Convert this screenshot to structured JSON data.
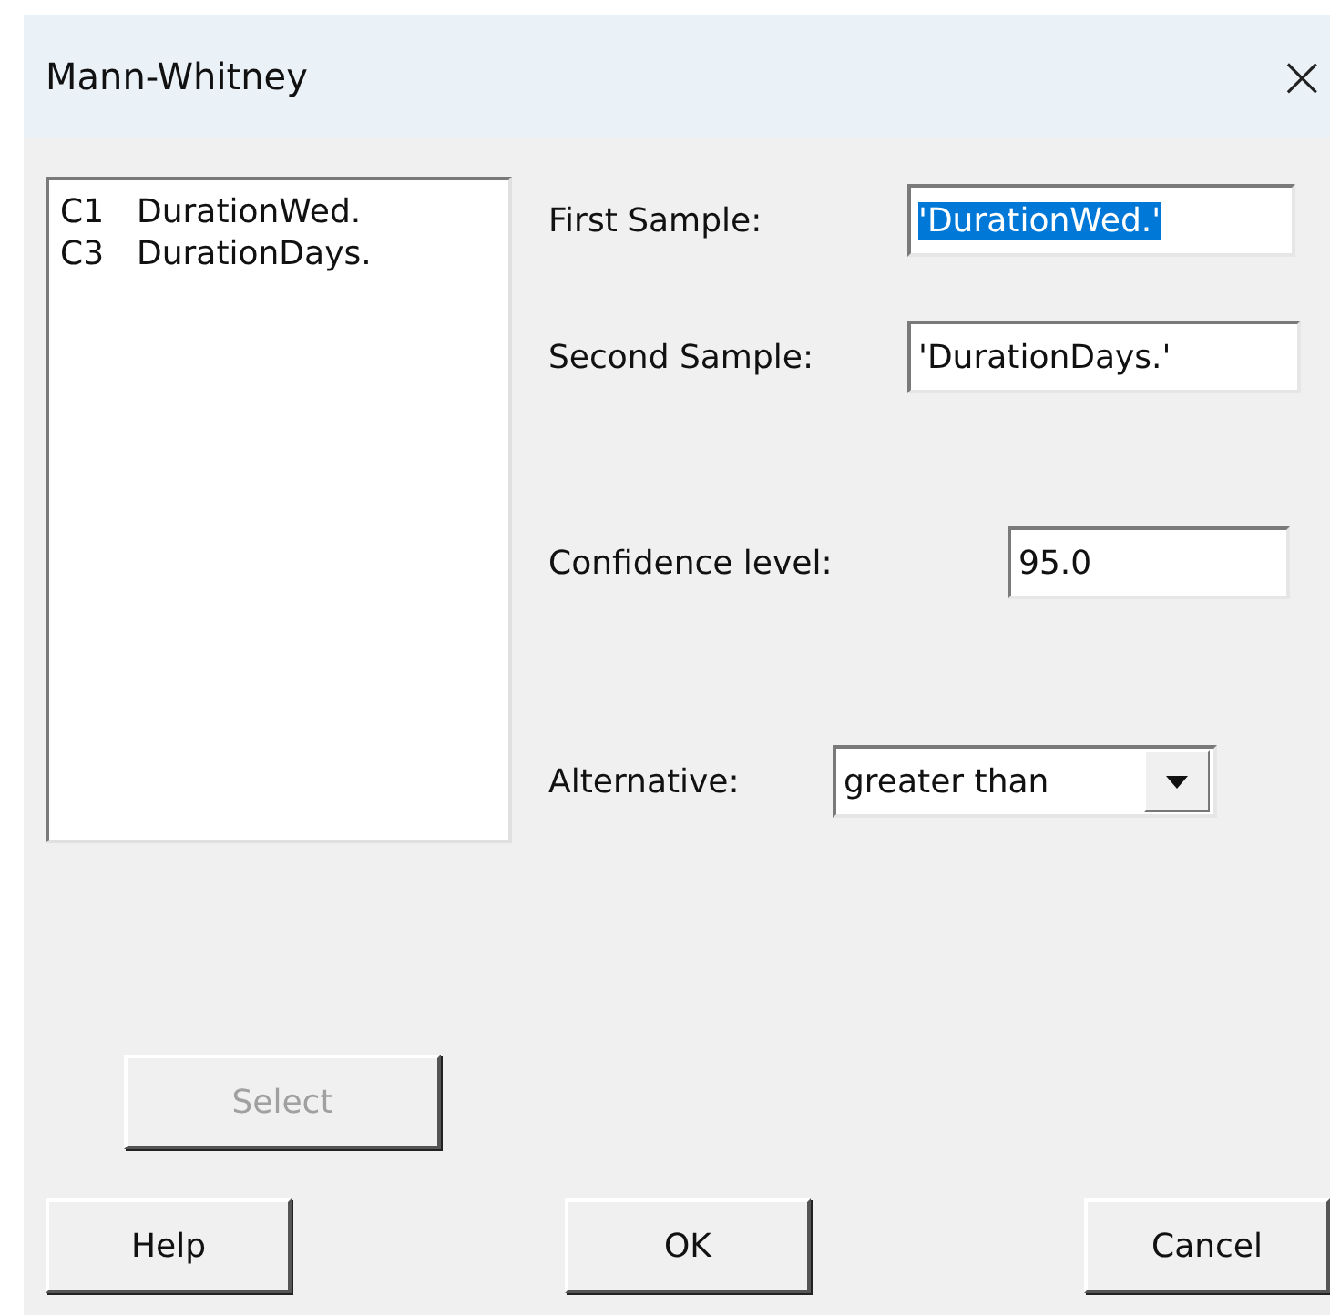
{
  "window": {
    "title": "Mann-Whitney",
    "close": "×"
  },
  "columns": [
    {
      "id": "C1",
      "name": "DurationWed."
    },
    {
      "id": "C3",
      "name": "DurationDays."
    }
  ],
  "fields": [
    {
      "label": "First Sample:",
      "value": "'DurationWed.'",
      "selected": true
    },
    {
      "label": "Second Sample:",
      "value": "'DurationDays.'",
      "selected": false
    },
    {
      "label": "Confidence level:",
      "value": "95.0",
      "selected": false
    }
  ],
  "alternative": {
    "label": "Alternative:",
    "value": "greater than"
  },
  "select_button": {
    "label": "Select",
    "disabled": true
  },
  "buttons": [
    "Help",
    "OK",
    "Cancel"
  ]
}
